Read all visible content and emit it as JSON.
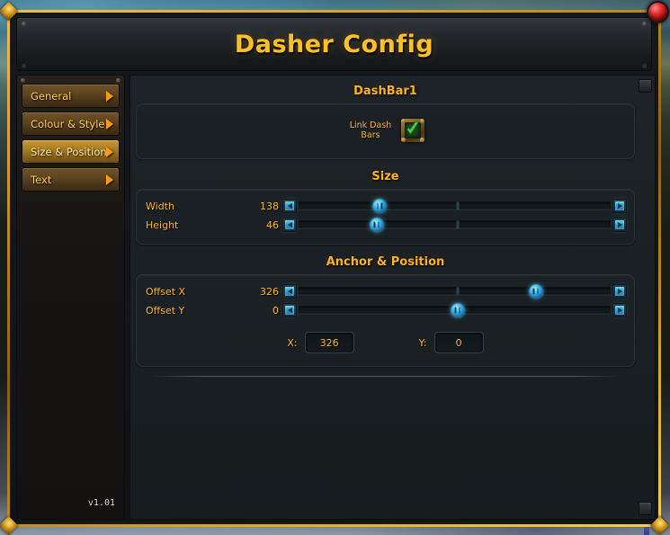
{
  "window": {
    "title": "Dasher Config",
    "close_icon": "close-circle-icon",
    "version": "v1.01"
  },
  "sidebar": {
    "items": [
      {
        "label": "General",
        "selected": false,
        "chevron": "chevron-right-icon"
      },
      {
        "label": "Colour & Style",
        "selected": false,
        "chevron": "chevron-right-icon"
      },
      {
        "label": "Size & Position",
        "selected": true,
        "chevron": "chevron-right-icon"
      },
      {
        "label": "Text",
        "selected": false,
        "chevron": "chevron-right-icon"
      }
    ]
  },
  "content": {
    "sections": [
      {
        "header": "DashBar1",
        "checkbox": {
          "label_line1": "Link Dash",
          "label_line2": "Bars",
          "checked": true,
          "icon": "checkmark-icon"
        }
      },
      {
        "header": "Size",
        "sliders": [
          {
            "label": "Width",
            "value": "138",
            "knob_pct": 26,
            "tick_pct": 51
          },
          {
            "label": "Height",
            "value": "46",
            "knob_pct": 25,
            "tick_pct": 51
          }
        ]
      },
      {
        "header": "Anchor & Position",
        "sliders": [
          {
            "label": "Offset X",
            "value": "326",
            "knob_pct": 76,
            "tick_pct": 51
          },
          {
            "label": "Offset Y",
            "value": "0",
            "knob_pct": 51,
            "tick_pct": 51
          }
        ],
        "xy": {
          "x_label": "X:",
          "x_value": "326",
          "y_label": "Y:",
          "y_value": "0"
        }
      }
    ]
  },
  "scrollbar": {
    "up_icon": "scroll-up-button",
    "down_icon": "scroll-down-button"
  },
  "colors": {
    "gold": "#ffc024",
    "amber_label": "#ffb619",
    "section_header": "#ffb317",
    "slider_blue": "#1f9fd0",
    "close_red": "#e63131",
    "check_green": "#3fc63f"
  }
}
